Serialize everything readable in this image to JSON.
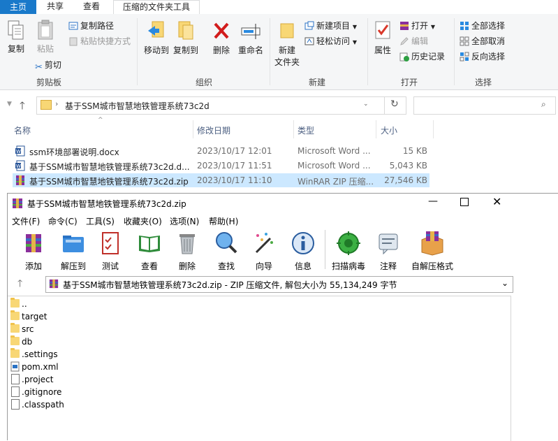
{
  "ribbon_tabs": [
    "主页",
    "共享",
    "查看",
    "压缩的文件夹工具"
  ],
  "ribbon": {
    "copy": "复制",
    "paste": "粘贴",
    "copy_path": "复制路径",
    "paste_shortcut": "粘贴快捷方式",
    "cut": "剪切",
    "group_clipboard": "剪贴板",
    "move_to": "移动到",
    "copy_to": "复制到",
    "delete": "删除",
    "rename": "重命名",
    "group_organize": "组织",
    "new_folder_1": "新建",
    "new_folder_2": "文件夹",
    "new_item": "新建项目",
    "easy_access": "轻松访问",
    "group_new": "新建",
    "properties": "属性",
    "open": "打开",
    "edit": "编辑",
    "history": "历史记录",
    "group_open": "打开",
    "select_all": "全部选择",
    "select_none": "全部取消",
    "invert_selection": "反向选择",
    "group_select": "选择"
  },
  "address": {
    "path": "基于SSM城市智慧地铁管理系统73c2d"
  },
  "columns": {
    "name": "名称",
    "date": "修改日期",
    "type": "类型",
    "size": "大小"
  },
  "files": [
    {
      "name": "ssm环境部署说明.docx",
      "date": "2023/10/17 12:01",
      "type": "Microsoft Word ...",
      "size": "15 KB"
    },
    {
      "name": "基于SSM城市智慧地铁管理系统73c2d.d...",
      "date": "2023/10/17 11:51",
      "type": "Microsoft Word ...",
      "size": "5,043 KB"
    },
    {
      "name": "基于SSM城市智慧地铁管理系统73c2d.zip",
      "date": "2023/10/17 11:10",
      "type": "WinRAR ZIP 压缩...",
      "size": "27,546 KB"
    }
  ],
  "rar": {
    "title": "基于SSM城市智慧地铁管理系统73c2d.zip",
    "menu": [
      "文件(F)",
      "命令(C)",
      "工具(S)",
      "收藏夹(O)",
      "选项(N)",
      "帮助(H)"
    ],
    "toolbar": [
      "添加",
      "解压到",
      "测试",
      "查看",
      "删除",
      "查找",
      "向导",
      "信息",
      "扫描病毒",
      "注释",
      "自解压格式"
    ],
    "path": "基于SSM城市智慧地铁管理系统73c2d.zip - ZIP 压缩文件, 解包大小为 55,134,249 字节",
    "entries": [
      {
        "name": "..",
        "kind": "folder"
      },
      {
        "name": "target",
        "kind": "folder"
      },
      {
        "name": "src",
        "kind": "folder"
      },
      {
        "name": "db",
        "kind": "folder"
      },
      {
        "name": ".settings",
        "kind": "folder"
      },
      {
        "name": "pom.xml",
        "kind": "xml"
      },
      {
        "name": ".project",
        "kind": "file"
      },
      {
        "name": ".gitignore",
        "kind": "file"
      },
      {
        "name": ".classpath",
        "kind": "file"
      }
    ]
  },
  "colors": {
    "selection": "#cce8ff",
    "accent": "#1a73e8"
  }
}
